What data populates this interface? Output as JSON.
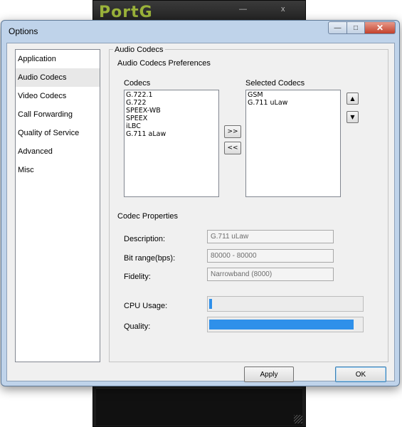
{
  "background_app": {
    "logo_text": "PortG",
    "minimize_glyph": "—",
    "close_glyph": "x"
  },
  "window": {
    "title": "Options",
    "minimize_icon": "—",
    "maximize_icon": "□",
    "close_icon": "✕"
  },
  "nav": {
    "items": [
      {
        "label": "Application"
      },
      {
        "label": "Audio Codecs"
      },
      {
        "label": "Video Codecs"
      },
      {
        "label": "Call Forwarding"
      },
      {
        "label": "Quality of Service"
      },
      {
        "label": "Advanced"
      },
      {
        "label": "Misc"
      }
    ],
    "selected_index": 1
  },
  "panel": {
    "group_title": "Audio Codecs",
    "prefs_heading": "Audio Codecs Preferences",
    "codecs_label": "Codecs",
    "selected_label": "Selected Codecs",
    "codecs": [
      "G.722.1",
      "G.722",
      "SPEEX-WB",
      "SPEEX",
      "iLBC",
      "G.711 aLaw"
    ],
    "selected_codecs": [
      "GSM",
      "G.711 uLaw"
    ],
    "add_button": ">>",
    "remove_button": "<<",
    "up_icon": "▲",
    "down_icon": "▼",
    "props_heading": "Codec Properties",
    "description_label": "Description:",
    "description_value": "G.711 uLaw",
    "bitrate_label": "Bit range(bps):",
    "bitrate_value": "80000 - 80000",
    "fidelity_label": "Fidelity:",
    "fidelity_value": "Narrowband (8000)",
    "cpu_label": "CPU Usage:",
    "cpu_level": 0.02,
    "quality_label": "Quality:",
    "quality_level": 0.95
  },
  "footer": {
    "apply_label": "Apply",
    "ok_label": "OK"
  },
  "colors": {
    "meter_fill": "#2f90ea",
    "titlebar": "#bfd3ea",
    "close_button": "#c3412b"
  }
}
